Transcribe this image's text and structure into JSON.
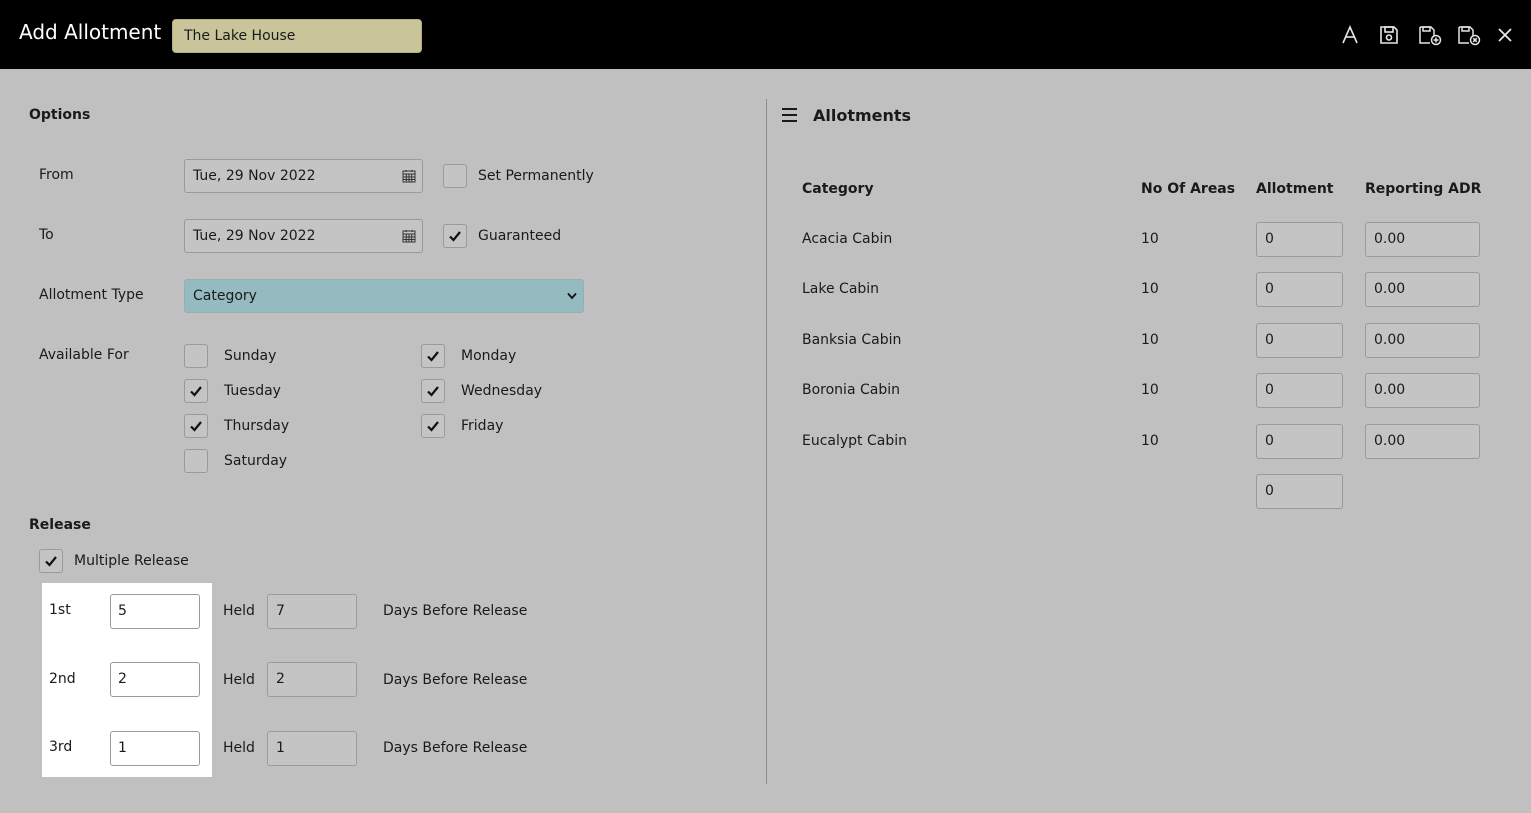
{
  "header": {
    "title": "Add Allotment",
    "property": "The Lake House",
    "icons": [
      "font-icon",
      "save-icon",
      "save-new-icon",
      "save-close-icon",
      "close-icon"
    ]
  },
  "options": {
    "section_title": "Options",
    "from_label": "From",
    "from_value": "Tue, 29 Nov 2022",
    "to_label": "To",
    "to_value": "Tue, 29 Nov 2022",
    "set_permanently": {
      "label": "Set Permanently",
      "checked": false
    },
    "guaranteed": {
      "label": "Guaranteed",
      "checked": true
    },
    "allotment_type_label": "Allotment Type",
    "allotment_type_value": "Category",
    "available_for_label": "Available For",
    "days": [
      {
        "label": "Sunday",
        "checked": false
      },
      {
        "label": "Monday",
        "checked": true
      },
      {
        "label": "Tuesday",
        "checked": true
      },
      {
        "label": "Wednesday",
        "checked": true
      },
      {
        "label": "Thursday",
        "checked": true
      },
      {
        "label": "Friday",
        "checked": true
      },
      {
        "label": "Saturday",
        "checked": false
      }
    ]
  },
  "release": {
    "section_title": "Release",
    "multiple_release": {
      "label": "Multiple Release",
      "checked": true
    },
    "held_label": "Held",
    "days_label": "Days Before Release",
    "rows": [
      {
        "label": "1st",
        "value": "5",
        "held": "7"
      },
      {
        "label": "2nd",
        "value": "2",
        "held": "2"
      },
      {
        "label": "3rd",
        "value": "1",
        "held": "1"
      }
    ]
  },
  "allotments": {
    "title": "Allotments",
    "columns": [
      "Category",
      "No Of Areas",
      "Allotment",
      "Reporting ADR"
    ],
    "rows": [
      {
        "category": "Acacia Cabin",
        "areas": "10",
        "allotment": "0",
        "adr": "0.00"
      },
      {
        "category": "Lake Cabin",
        "areas": "10",
        "allotment": "0",
        "adr": "0.00"
      },
      {
        "category": "Banksia Cabin",
        "areas": "10",
        "allotment": "0",
        "adr": "0.00"
      },
      {
        "category": "Boronia Cabin",
        "areas": "10",
        "allotment": "0",
        "adr": "0.00"
      },
      {
        "category": "Eucalypt Cabin",
        "areas": "10",
        "allotment": "0",
        "adr": "0.00"
      }
    ],
    "total_allotment": "0"
  }
}
